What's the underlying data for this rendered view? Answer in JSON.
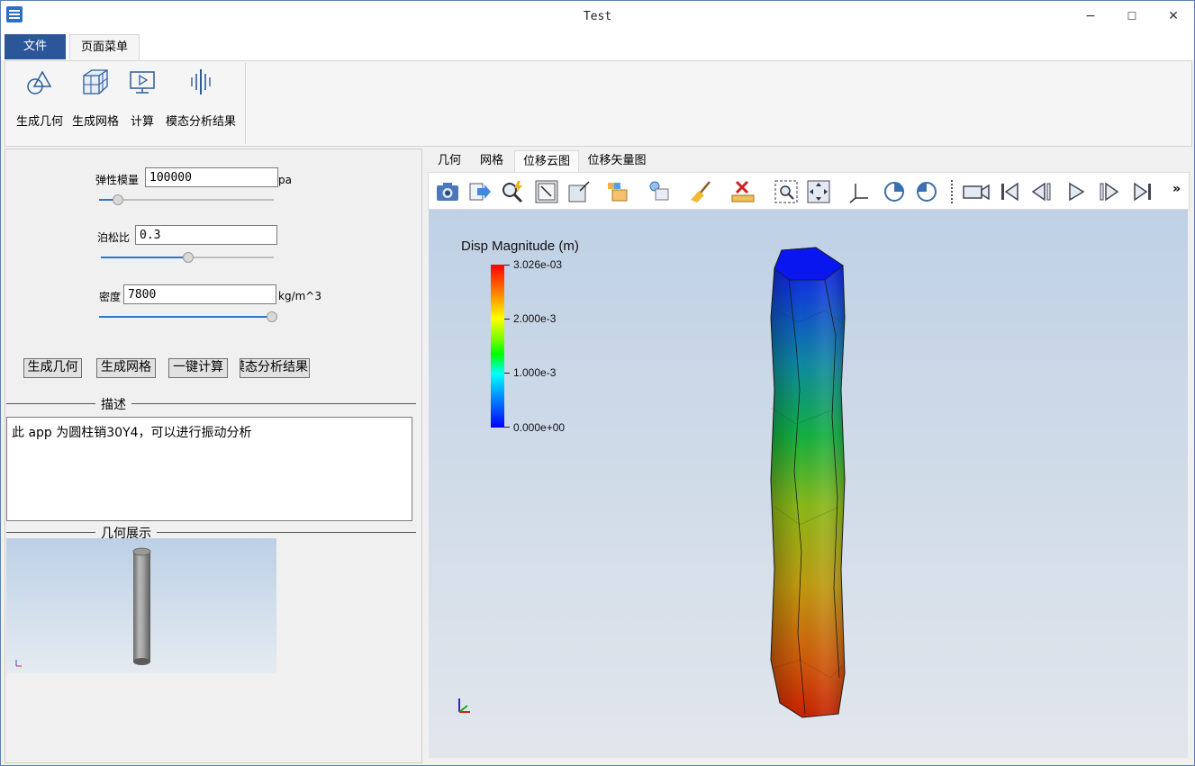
{
  "window": {
    "title": "Test",
    "controls": {
      "minimize": "−",
      "maximize": "☐",
      "close": "✕"
    }
  },
  "menu": {
    "tabs": [
      {
        "label": "文件"
      },
      {
        "label": "页面菜单"
      }
    ]
  },
  "ribbon": {
    "buttons": [
      {
        "label": "生成几何",
        "icon": "geometry-icon"
      },
      {
        "label": "生成网格",
        "icon": "mesh-cube-icon"
      },
      {
        "label": "计算",
        "icon": "compute-monitor-icon"
      },
      {
        "label": "模态分析结果",
        "icon": "modal-result-icon"
      }
    ]
  },
  "params": {
    "elastic": {
      "label": "弹性模量",
      "value": "100000",
      "unit": "pa",
      "slider": 0.08
    },
    "poisson": {
      "label": "泊松比",
      "value": "0.3",
      "slider": 0.5
    },
    "density": {
      "label": "密度",
      "value": "7800",
      "unit": "kg/m^3",
      "slider": 1.0
    }
  },
  "actions": [
    "生成几何",
    "生成网格",
    "一键计算",
    "模态分析结果"
  ],
  "description": {
    "title": "描述",
    "text": "此 app 为圆柱销30Y4，可以进行振动分析"
  },
  "preview": {
    "title": "几何展示"
  },
  "viewer": {
    "tabs": [
      {
        "label": "几何",
        "active": false
      },
      {
        "label": "网格",
        "active": false
      },
      {
        "label": "位移云图",
        "active": true
      },
      {
        "label": "位移矢量图",
        "active": false
      }
    ],
    "toolbar": [
      "camera-icon",
      "export-arrow-icon",
      "query-zoom-icon",
      "zoom-to-box-icon",
      "zoom-out-box-icon",
      "representation-icon",
      "light-icon",
      "clean-brush-icon",
      "ruler-delete-icon",
      "rubber-zoom-icon",
      "fit-view-icon",
      "axes-icon",
      "rotate-cw-icon",
      "rotate-ccw-icon",
      "video-camera-icon",
      "first-frame-icon",
      "prev-frame-icon",
      "play-icon",
      "next-frame-icon",
      "last-frame-icon",
      "more-icon"
    ],
    "overflow": "»",
    "legend": {
      "title": "Disp Magnitude (m)",
      "max": "3.026e-03",
      "mid_high": "2.000e-3",
      "mid_low": "1.000e-3",
      "min": "0.000e+00"
    }
  }
}
